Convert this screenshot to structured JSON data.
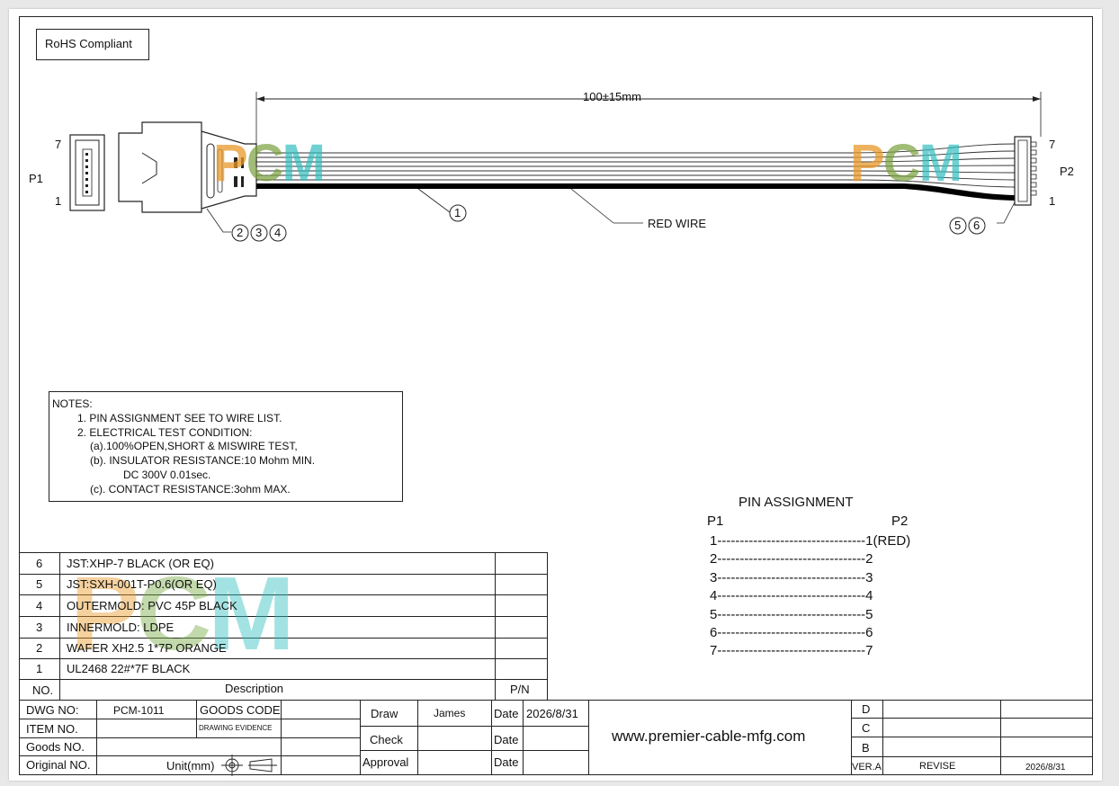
{
  "rohs_label": "RoHS Compliant",
  "dimension_label": "100±15mm",
  "connector_p1": {
    "label": "P1",
    "pin_top": "7",
    "pin_bottom": "1"
  },
  "connector_p2": {
    "label": "P2",
    "pin_top": "7",
    "pin_bottom": "1"
  },
  "callouts": {
    "c1": "1",
    "c2": "2",
    "c3": "3",
    "c4": "4",
    "c5": "5",
    "c6": "6",
    "red_wire": "RED WIRE"
  },
  "watermark": "PCM",
  "notes": {
    "header": "NOTES:",
    "lines": [
      "1. PIN ASSIGNMENT SEE TO WIRE LIST.",
      "2. ELECTRICAL TEST CONDITION:",
      "(a).100%OPEN,SHORT & MISWIRE TEST,",
      "(b). INSULATOR RESISTANCE:10 Mohm MIN.",
      "DC 300V 0.01sec.",
      "(c). CONTACT RESISTANCE:3ohm MAX."
    ]
  },
  "pin_assignment": {
    "title": "PIN  ASSIGNMENT",
    "col_p1": "P1",
    "col_p2": "P2",
    "rows": [
      "1---------------------------------1(RED)",
      "2---------------------------------2",
      "3---------------------------------3",
      "4---------------------------------4",
      "5---------------------------------5",
      "6---------------------------------6",
      "7---------------------------------7"
    ]
  },
  "bom": {
    "rows": [
      {
        "no": "6",
        "desc": "JST:XHP-7 BLACK (OR EQ)",
        "pn": ""
      },
      {
        "no": "5",
        "desc": "JST:SXH-001T-P0.6(OR EQ)",
        "pn": ""
      },
      {
        "no": "4",
        "desc": "OUTERMOLD: PVC 45P BLACK",
        "pn": ""
      },
      {
        "no": "3",
        "desc": "INNERMOLD: LDPE",
        "pn": ""
      },
      {
        "no": "2",
        "desc": "WAFER XH2.5  1*7P ORANGE",
        "pn": ""
      },
      {
        "no": "1",
        "desc": "UL2468 22#*7F  BLACK",
        "pn": ""
      }
    ],
    "header": {
      "no": "NO.",
      "desc": "Description",
      "pn": "P/N"
    }
  },
  "title_block": {
    "dwg_no_label": "DWG NO:",
    "dwg_no": "PCM-1011",
    "goods_code_label": "GOODS CODE",
    "item_no_label": "ITEM NO.",
    "drawing_evidence": "DRAWING EVIDENCE",
    "goods_no_label": "Goods NO.",
    "original_no_label": "Original NO.",
    "unit_label": "Unit(mm)",
    "draw_label": "Draw",
    "draw_name": "James",
    "check_label": "Check",
    "approval_label": "Approval",
    "date_label": "Date",
    "date_value": "2026/8/31",
    "website": "www.premier-cable-mfg.com",
    "rev_d": "D",
    "rev_c": "C",
    "rev_b": "B",
    "ver_label": "VER.A",
    "revise_label": "REVISE",
    "rev_date": "2026/8/31"
  }
}
